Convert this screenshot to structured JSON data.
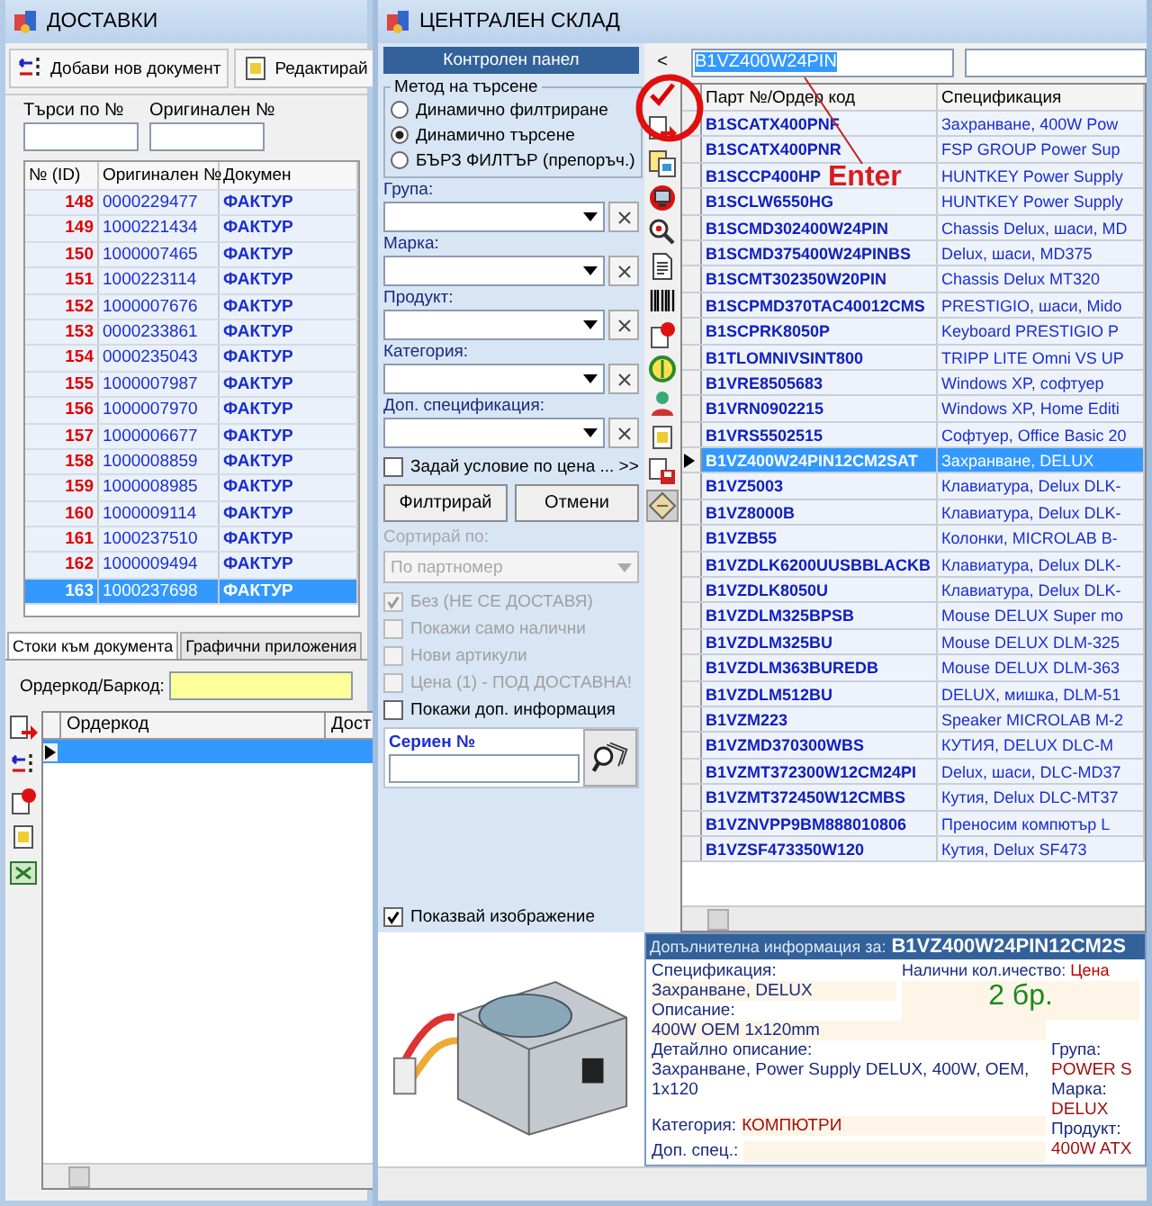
{
  "back_window": {
    "title": "ДОСТАВКИ",
    "toolbar": [
      {
        "label": "Добави нов документ",
        "kind": "add"
      },
      {
        "label": "Редактирай",
        "kind": "edit"
      }
    ],
    "search_fields": [
      {
        "label": "Търси по №"
      },
      {
        "label": "Оригинален №"
      }
    ],
    "table": {
      "columns": [
        "№ (ID)",
        "Оригинален №",
        "Докумен"
      ],
      "rows": [
        {
          "id": "148",
          "original": "0000229477",
          "document": "ФАКТУР",
          "selected": false
        },
        {
          "id": "149",
          "original": "1000221434",
          "document": "ФАКТУР",
          "selected": false
        },
        {
          "id": "150",
          "original": "1000007465",
          "document": "ФАКТУР",
          "selected": false
        },
        {
          "id": "151",
          "original": "1000223114",
          "document": "ФАКТУР",
          "selected": false
        },
        {
          "id": "152",
          "original": "1000007676",
          "document": "ФАКТУР",
          "selected": false
        },
        {
          "id": "153",
          "original": "0000233861",
          "document": "ФАКТУР",
          "selected": false
        },
        {
          "id": "154",
          "original": "0000235043",
          "document": "ФАКТУР",
          "selected": false
        },
        {
          "id": "155",
          "original": "1000007987",
          "document": "ФАКТУР",
          "selected": false
        },
        {
          "id": "156",
          "original": "1000007970",
          "document": "ФАКТУР",
          "selected": false
        },
        {
          "id": "157",
          "original": "1000006677",
          "document": "ФАКТУР",
          "selected": false
        },
        {
          "id": "158",
          "original": "1000008859",
          "document": "ФАКТУР",
          "selected": false
        },
        {
          "id": "159",
          "original": "1000008985",
          "document": "ФАКТУР",
          "selected": false
        },
        {
          "id": "160",
          "original": "1000009114",
          "document": "ФАКТУР",
          "selected": false
        },
        {
          "id": "161",
          "original": "1000237510",
          "document": "ФАКТУР",
          "selected": false
        },
        {
          "id": "162",
          "original": "1000009494",
          "document": "ФАКТУР",
          "selected": false
        },
        {
          "id": "163",
          "original": "1000237698",
          "document": "ФАКТУР",
          "selected": true
        }
      ]
    },
    "tabs": [
      {
        "label": "Стоки към документа",
        "selected": true
      },
      {
        "label": "Графични приложения",
        "selected": false
      }
    ],
    "barcode_field": {
      "label": "Ордеркод/Баркод:"
    },
    "items_table": {
      "columns": [
        "Ордеркод",
        "Дост"
      ]
    }
  },
  "main_window": {
    "title": "ЦЕНТРАЛЕН СКЛАД",
    "control_panel": {
      "title": "Контролен панел",
      "search_method": {
        "legend": "Метод на търсене",
        "options": [
          {
            "label": "Динамично филтриране",
            "selected": false
          },
          {
            "label": "Динамично търсене",
            "selected": true
          },
          {
            "label": "БЪРЗ ФИЛТЪР (препоръч.)",
            "selected": false
          }
        ]
      },
      "filters": [
        {
          "label": "Група:"
        },
        {
          "label": "Марка:"
        },
        {
          "label": "Продукт:"
        },
        {
          "label": "Категория:"
        },
        {
          "label": "Доп. спецификация:"
        }
      ],
      "price_condition": {
        "label": "Задай условие по цена ... >>",
        "checked": false
      },
      "buttons": [
        "Филтрирай",
        "Отмени"
      ],
      "sort": {
        "label": "Сортирай по:",
        "value": "По партномер",
        "disabled": true
      },
      "options": [
        {
          "label": "Без (НЕ СЕ ДОСТАВЯ)",
          "checked": true,
          "disabled": true
        },
        {
          "label": "Покажи само налични",
          "checked": false,
          "disabled": true
        },
        {
          "label": "Нови артикули",
          "checked": false,
          "disabled": true
        },
        {
          "label": "Цена (1) - ПОД ДОСТАВНА!",
          "checked": false,
          "disabled": true
        },
        {
          "label": "Покажи доп. информация",
          "checked": false,
          "disabled": false
        }
      ],
      "serial": {
        "label": "Сериен №"
      },
      "show_image": {
        "label": "Показвай изображение",
        "checked": true
      }
    },
    "collapse_button": "<",
    "search": {
      "value": "B1VZ400W24PIN"
    },
    "grid": {
      "columns": [
        "Парт №/Ордер код",
        "Спецификация"
      ],
      "rows": [
        {
          "part": "B1SCATX400PNF",
          "spec": "Захранване, 400W Pow",
          "selected": false
        },
        {
          "part": "B1SCATX400PNR",
          "spec": "FSP GROUP Power Sup",
          "selected": false
        },
        {
          "part": "B1SCCP400HP",
          "spec": "HUNTKEY Power Supply",
          "selected": false
        },
        {
          "part": "B1SCLW6550HG",
          "spec": "HUNTKEY Power Supply",
          "selected": false
        },
        {
          "part": "B1SCMD302400W24PIN",
          "spec": "Chassis Delux, шаси, MD",
          "selected": false
        },
        {
          "part": "B1SCMD375400W24PINBS",
          "spec": "Delux, шаси, MD375",
          "selected": false
        },
        {
          "part": "B1SCMT302350W20PIN",
          "spec": "Chassis Delux MT320",
          "selected": false
        },
        {
          "part": "B1SCPMD370TAC40012CMS",
          "spec": "PRESTIGIO, шаси, Mido",
          "selected": false
        },
        {
          "part": "B1SCPRK8050P",
          "spec": "Keyboard PRESTIGIO P",
          "selected": false
        },
        {
          "part": "B1TLOMNIVSINT800",
          "spec": "TRIPP LITE Omni VS UP",
          "selected": false
        },
        {
          "part": "B1VRE8505683",
          "spec": "Windows XP, софтуер",
          "selected": false
        },
        {
          "part": "B1VRN0902215",
          "spec": "Windows XP, Home Editi",
          "selected": false
        },
        {
          "part": "B1VRS5502515",
          "spec": "Софтуер, Office Basic 20",
          "selected": false
        },
        {
          "part": "B1VZ400W24PIN12CM2SAT",
          "spec": "Захранване, DELUX",
          "selected": true
        },
        {
          "part": "B1VZ5003",
          "spec": "Клавиатура, Delux DLK-",
          "selected": false
        },
        {
          "part": "B1VZ8000B",
          "spec": "Клавиатура, Delux DLK-",
          "selected": false
        },
        {
          "part": "B1VZB55",
          "spec": "Колонки, MICROLAB B-",
          "selected": false
        },
        {
          "part": "B1VZDLK6200UUSBBLACKB",
          "spec": "Клавиатура, Delux DLK-",
          "selected": false
        },
        {
          "part": "B1VZDLK8050U",
          "spec": "Клавиатура, Delux DLK-",
          "selected": false
        },
        {
          "part": "B1VZDLM325BPSB",
          "spec": "Mouse DELUX Super mo",
          "selected": false
        },
        {
          "part": "B1VZDLM325BU",
          "spec": "Mouse DELUX DLM-325",
          "selected": false
        },
        {
          "part": "B1VZDLM363BUREDB",
          "spec": "Mouse DELUX DLM-363",
          "selected": false
        },
        {
          "part": "B1VZDLM512BU",
          "spec": "DELUX, мишка, DLM-51",
          "selected": false
        },
        {
          "part": "B1VZM223",
          "spec": "Speaker MICROLAB M-2",
          "selected": false
        },
        {
          "part": "B1VZMD370300WBS",
          "spec": "КУТИЯ, DELUX DLC-M",
          "selected": false
        },
        {
          "part": "B1VZMT372300W12CM24PI",
          "spec": "Delux, шаси, DLC-MD37",
          "selected": false
        },
        {
          "part": "B1VZMT372450W12CMBS",
          "spec": "Кутия, Delux DLC-MT37",
          "selected": false
        },
        {
          "part": "B1VZNVPP9BM888010806",
          "spec": "Преносим компютър L",
          "selected": false
        },
        {
          "part": "B1VZSF473350W120",
          "spec": "Кутия, Delux SF473",
          "selected": false
        }
      ]
    },
    "info": {
      "title": "Допълнителна информация за:",
      "part": "B1VZ400W24PIN12CM2S",
      "spec_label": "Спецификация:",
      "spec": "Захранване, DELUX",
      "qty_label": "Налични кол.ичество:",
      "price_label": "Цена",
      "qty": "2 бр.",
      "desc_label": "Описание:",
      "desc": "400W OEM 1x120mm",
      "detail_label": "Детайлно описание:",
      "detail": "Захранване, Power Supply DELUX, 400W, OEM, 1x120",
      "category_label": "Категория:",
      "category": "КОМПЮТРИ",
      "extra_label": "Доп. спец.:",
      "group_label": "Група:",
      "group": "POWER S",
      "brand_label": "Марка:",
      "brand": "DELUX",
      "product_label": "Продукт:",
      "product": "400W ATX"
    }
  },
  "annotation": {
    "text": "Enter"
  }
}
